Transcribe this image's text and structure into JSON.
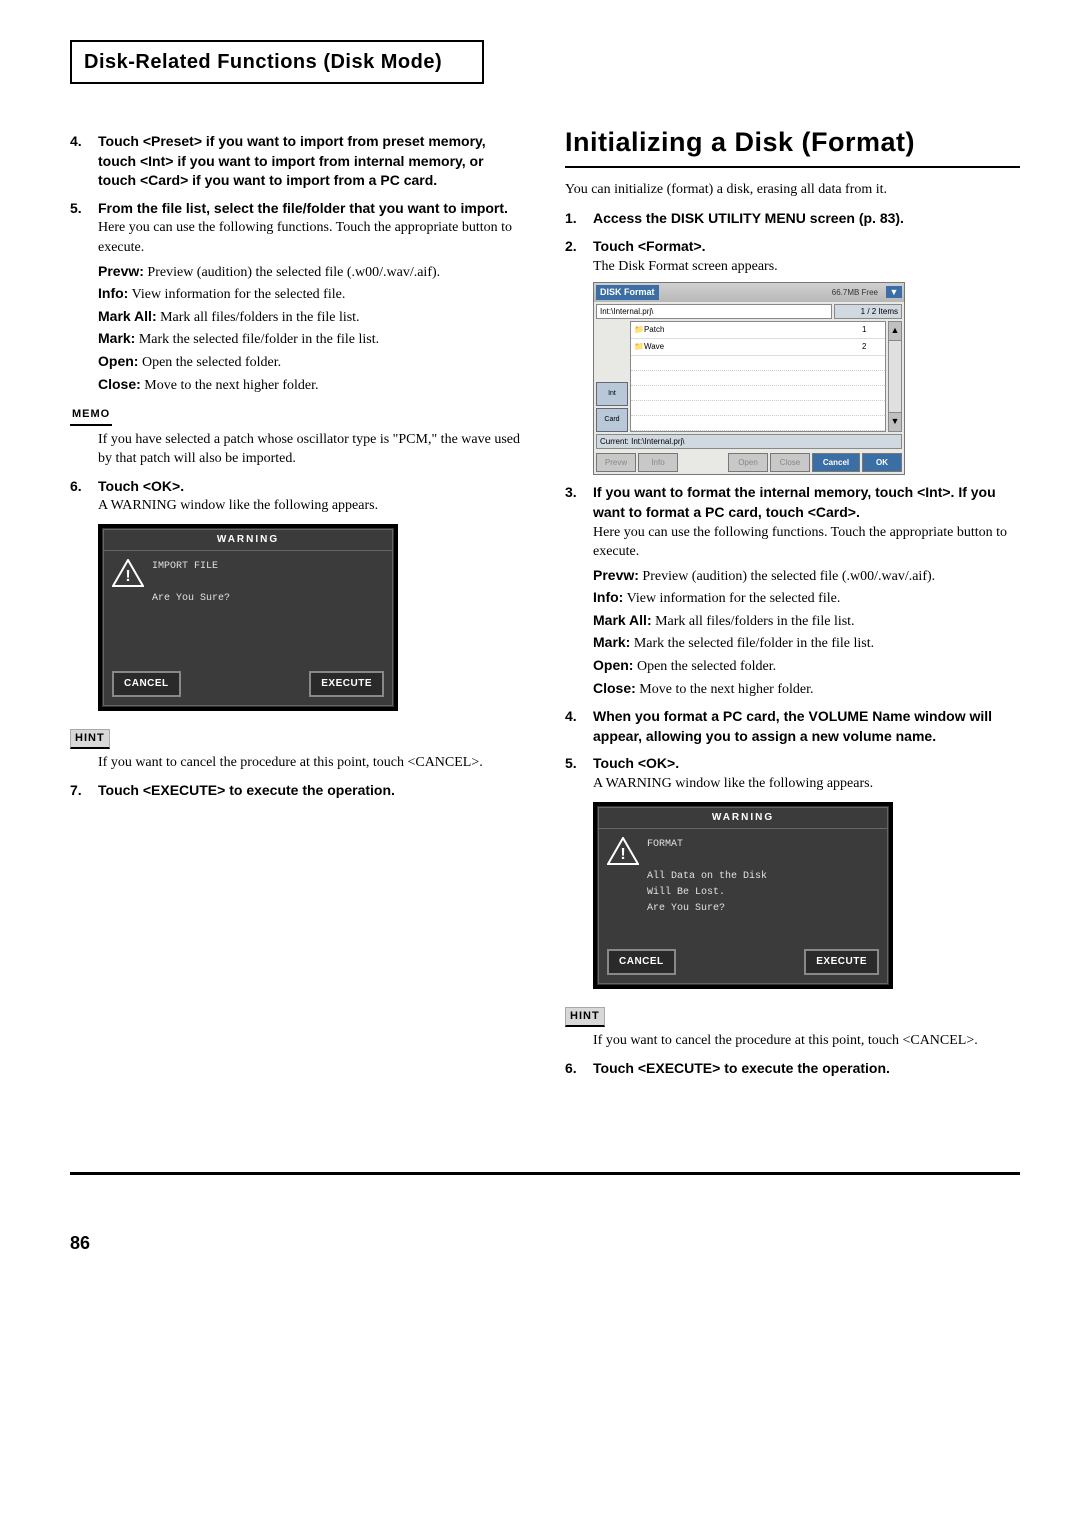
{
  "chapter_title": "Disk-Related Functions (Disk Mode)",
  "left": {
    "step4": {
      "num": "4.",
      "text": "Touch <Preset> if you want to import from preset memory, touch <Int> if you want to import from internal memory, or touch <Card> if you want to import from a PC card."
    },
    "step5": {
      "num": "5.",
      "title": "From the file list, select the file/folder that you want to import.",
      "body": "Here you can use the following functions. Touch the appropriate button to execute."
    },
    "funcs": {
      "prevw": {
        "label": "Prevw:",
        "text": " Preview (audition) the selected file (.w00/.wav/.aif)."
      },
      "info": {
        "label": "Info:",
        "text": " View information for the selected file."
      },
      "markall": {
        "label": "Mark All:",
        "text": " Mark all files/folders in the file list."
      },
      "mark": {
        "label": "Mark:",
        "text": " Mark the selected file/folder in the file list."
      },
      "open": {
        "label": "Open:",
        "text": " Open the selected folder."
      },
      "close": {
        "label": "Close:",
        "text": " Move to the next higher folder."
      }
    },
    "memo_label": "MEMO",
    "memo_text": "If you have selected a patch whose oscillator type is \"PCM,\" the wave used by that patch will also be imported.",
    "step6": {
      "num": "6.",
      "title": "Touch <OK>.",
      "body": "A WARNING window like the following appears."
    },
    "warning": {
      "title": "WARNING",
      "line1": "IMPORT FILE",
      "line2": "Are You Sure?",
      "cancel": "CANCEL",
      "execute": "EXECUTE"
    },
    "hint_label": "HINT",
    "hint_text": "If you want to cancel the procedure at this point, touch <CANCEL>.",
    "step7": {
      "num": "7.",
      "title": "Touch <EXECUTE> to execute the operation."
    }
  },
  "right": {
    "heading": "Initializing a Disk (Format)",
    "intro": "You can initialize (format) a disk, erasing all data from it.",
    "step1": {
      "num": "1.",
      "title": "Access the DISK UTILITY MENU screen (p. 83)."
    },
    "step2": {
      "num": "2.",
      "title": "Touch <Format>.",
      "body": "The Disk Format screen appears."
    },
    "df": {
      "title": "DISK Format",
      "free": "66.7MB Free",
      "path": "Int:\\Internal.prj\\",
      "count": "1 / 2 Items",
      "rows": [
        {
          "name": "📁Patch",
          "idx": "1"
        },
        {
          "name": "📁Wave",
          "idx": "2"
        }
      ],
      "side1": "Int",
      "side2": "Card",
      "current": "Current: Int:\\Internal.prj\\",
      "prevw": "Prevw",
      "info": "Info",
      "open": "Open",
      "close": "Close",
      "cancel": "Cancel",
      "ok": "OK"
    },
    "step3": {
      "num": "3.",
      "title": "If you want to format the internal memory, touch <Int>. If you want to format a PC card, touch <Card>.",
      "body": "Here you can use the following functions. Touch the appropriate button to execute."
    },
    "funcs": {
      "prevw": {
        "label": "Prevw:",
        "text": " Preview (audition) the selected file (.w00/.wav/.aif)."
      },
      "info": {
        "label": "Info:",
        "text": " View information for the selected file."
      },
      "markall": {
        "label": "Mark All:",
        "text": " Mark all files/folders in the file list."
      },
      "mark": {
        "label": "Mark:",
        "text": " Mark the selected file/folder in the file list."
      },
      "open": {
        "label": "Open:",
        "text": " Open the selected folder."
      },
      "close": {
        "label": "Close:",
        "text": " Move to the next higher folder."
      }
    },
    "step4": {
      "num": "4.",
      "title": "When you format a PC card, the VOLUME Name window will appear, allowing you to assign a new volume name."
    },
    "step5": {
      "num": "5.",
      "title": "Touch <OK>.",
      "body": "A WARNING window like the following appears."
    },
    "warning": {
      "title": "WARNING",
      "line1": "FORMAT",
      "line2": "All Data on the Disk",
      "line3": "Will Be Lost.",
      "line4": "Are You Sure?",
      "cancel": "CANCEL",
      "execute": "EXECUTE"
    },
    "hint_label": "HINT",
    "hint_text": "If you want to cancel the procedure at this point, touch <CANCEL>.",
    "step6": {
      "num": "6.",
      "title": "Touch <EXECUTE> to execute the operation."
    }
  },
  "page_number": "86"
}
